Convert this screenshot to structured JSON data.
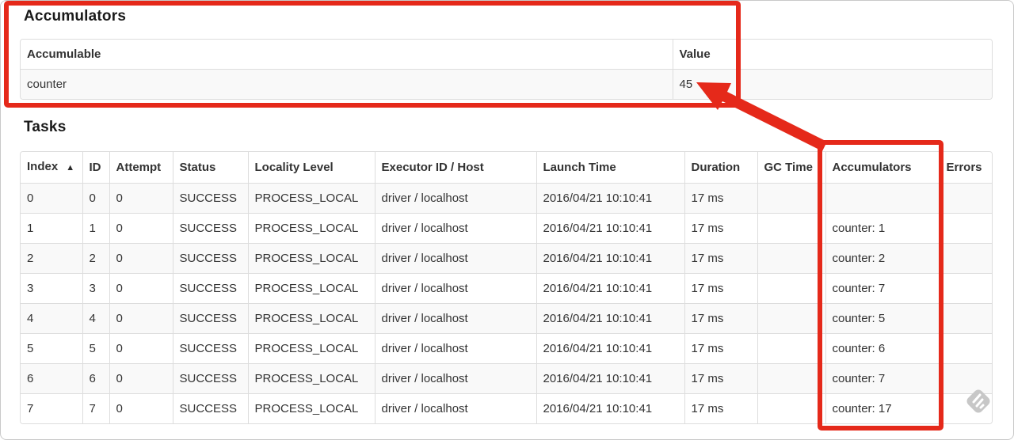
{
  "accumulators_section": {
    "title": "Accumulators",
    "table": {
      "sortable": false,
      "sort_icon": "▲",
      "columns": [
        {
          "label": "Accumulable"
        },
        {
          "label": "Value"
        }
      ],
      "rows": [
        [
          "counter",
          "45"
        ]
      ]
    }
  },
  "tasks_section": {
    "title": "Tasks",
    "table": {
      "sortable": true,
      "sort_icon": "▲",
      "columns": [
        {
          "label": "Index",
          "sorted": "asc"
        },
        {
          "label": "ID"
        },
        {
          "label": "Attempt"
        },
        {
          "label": "Status"
        },
        {
          "label": "Locality Level"
        },
        {
          "label": "Executor ID / Host"
        },
        {
          "label": "Launch Time"
        },
        {
          "label": "Duration"
        },
        {
          "label": "GC Time"
        },
        {
          "label": "Accumulators"
        },
        {
          "label": "Errors"
        }
      ],
      "rows": [
        [
          "0",
          "0",
          "0",
          "SUCCESS",
          "PROCESS_LOCAL",
          "driver / localhost",
          "2016/04/21 10:10:41",
          "17 ms",
          "",
          "",
          ""
        ],
        [
          "1",
          "1",
          "0",
          "SUCCESS",
          "PROCESS_LOCAL",
          "driver / localhost",
          "2016/04/21 10:10:41",
          "17 ms",
          "",
          "counter: 1",
          ""
        ],
        [
          "2",
          "2",
          "0",
          "SUCCESS",
          "PROCESS_LOCAL",
          "driver / localhost",
          "2016/04/21 10:10:41",
          "17 ms",
          "",
          "counter: 2",
          ""
        ],
        [
          "3",
          "3",
          "0",
          "SUCCESS",
          "PROCESS_LOCAL",
          "driver / localhost",
          "2016/04/21 10:10:41",
          "17 ms",
          "",
          "counter: 7",
          ""
        ],
        [
          "4",
          "4",
          "0",
          "SUCCESS",
          "PROCESS_LOCAL",
          "driver / localhost",
          "2016/04/21 10:10:41",
          "17 ms",
          "",
          "counter: 5",
          ""
        ],
        [
          "5",
          "5",
          "0",
          "SUCCESS",
          "PROCESS_LOCAL",
          "driver / localhost",
          "2016/04/21 10:10:41",
          "17 ms",
          "",
          "counter: 6",
          ""
        ],
        [
          "6",
          "6",
          "0",
          "SUCCESS",
          "PROCESS_LOCAL",
          "driver / localhost",
          "2016/04/21 10:10:41",
          "17 ms",
          "",
          "counter: 7",
          ""
        ],
        [
          "7",
          "7",
          "0",
          "SUCCESS",
          "PROCESS_LOCAL",
          "driver / localhost",
          "2016/04/21 10:10:41",
          "17 ms",
          "",
          "counter: 17",
          ""
        ]
      ]
    }
  },
  "annotations": {
    "highlight_color": "#e5291a",
    "boxes": [
      "accumulators-summary-highlight",
      "tasks-accumulators-column-highlight"
    ],
    "arrow": "from-accumulators-column-to-total-value"
  },
  "icons": {
    "sort_ascending": "▲",
    "watermark": "annotation-app-watermark",
    "watermark_color": "#c7c7c7"
  }
}
